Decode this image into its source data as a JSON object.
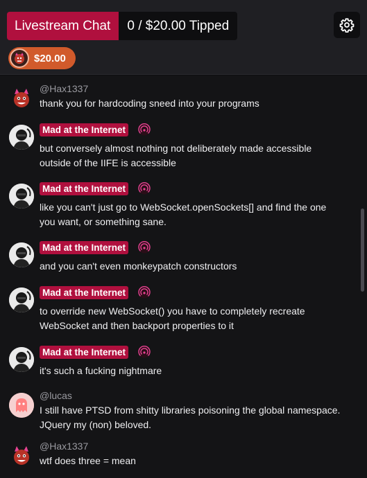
{
  "header": {
    "title": "Livestream Chat",
    "tipped": "0 / $20.00 Tipped",
    "settings_icon": "gear-icon",
    "tip_chip_amount": "$20.00"
  },
  "colors": {
    "accent": "#b0103e",
    "chip": "#d15a2b",
    "background": "#141416"
  },
  "messages": [
    {
      "user": "@Hax1337",
      "type": "handle",
      "avatar": "hax",
      "lines": [
        "thank you for hardcoding sneed into your programs"
      ]
    },
    {
      "user": "Mad at the Internet",
      "type": "badge",
      "avatar": "mad",
      "lines": [
        "but conversely almost nothing not deliberately made accessible",
        "outside of the IIFE is accessible"
      ]
    },
    {
      "user": "Mad at the Internet",
      "type": "badge",
      "avatar": "mad",
      "lines": [
        "like you can't just go to WebSocket.openSockets[] and find the one",
        "you want, or something sane."
      ]
    },
    {
      "user": "Mad at the Internet",
      "type": "badge",
      "avatar": "mad",
      "lines": [
        "and you can't even monkeypatch constructors"
      ]
    },
    {
      "user": "Mad at the Internet",
      "type": "badge",
      "avatar": "mad",
      "lines": [
        "to override new WebSocket() you have to completely recreate",
        "WebSocket and then backport properties to it"
      ]
    },
    {
      "user": "Mad at the Internet",
      "type": "badge",
      "avatar": "mad",
      "lines": [
        "it's such a fucking nightmare"
      ]
    },
    {
      "user": "@lucas",
      "type": "handle",
      "avatar": "lucas",
      "lines": [
        "I still have PTSD from shitty libraries poisoning the global namespace.",
        "JQuery my (non) beloved."
      ]
    },
    {
      "user": "@Hax1337",
      "type": "handle",
      "avatar": "hax",
      "lines": [
        "wtf does three = mean"
      ]
    }
  ]
}
